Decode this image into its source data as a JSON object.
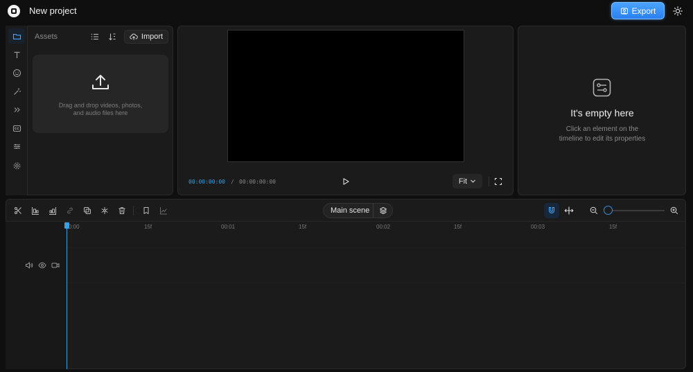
{
  "header": {
    "title": "New project",
    "export_label": "Export",
    "logo_icon": "app-logo-icon",
    "theme_icon": "sun-icon"
  },
  "sidebar": {
    "items": [
      {
        "name": "folder",
        "icon": "folder-icon",
        "active": true
      },
      {
        "name": "text",
        "icon": "text-icon"
      },
      {
        "name": "stickers",
        "icon": "smiley-icon"
      },
      {
        "name": "effects",
        "icon": "magic-wand-icon"
      },
      {
        "name": "transitions",
        "icon": "chevrons-right-icon"
      },
      {
        "name": "captions",
        "icon": "captions-icon"
      },
      {
        "name": "adjust",
        "icon": "sliders-icon"
      },
      {
        "name": "settings",
        "icon": "gear-icon"
      }
    ]
  },
  "assets": {
    "label": "Assets",
    "import_label": "Import",
    "dropzone_line1": "Drag and drop videos, photos,",
    "dropzone_line2": "and audio files here"
  },
  "player": {
    "current_time": "00:00:00:00",
    "separator": "/",
    "total_time": "00:00:00:00",
    "fit_label": "Fit"
  },
  "properties": {
    "empty_title": "It's empty here",
    "empty_subtitle_line1": "Click an element on the",
    "empty_subtitle_line2": "timeline to edit its properties"
  },
  "timeline": {
    "scene_label": "Main scene",
    "ruler": [
      {
        "label": "0:00"
      },
      {
        "label": "15f"
      },
      {
        "label": "00:01"
      },
      {
        "label": "15f"
      },
      {
        "label": "00:02"
      },
      {
        "label": "15f"
      },
      {
        "label": "00:03"
      },
      {
        "label": "15f"
      }
    ]
  },
  "colors": {
    "accent": "#3aa0e6",
    "export_button": "#2b7ff0",
    "background": "#0f0f0f",
    "panel": "#1b1b1b"
  }
}
